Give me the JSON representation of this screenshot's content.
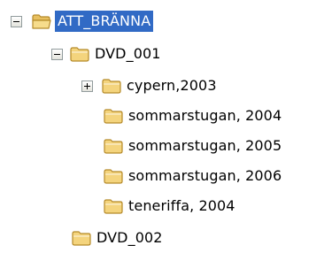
{
  "colors": {
    "selection_background": "#316ac5",
    "selection_text": "#ffffff",
    "folder_fill": "#f4d47d",
    "folder_outline": "#b58a2a",
    "expander_border": "#919b9c"
  },
  "tree": {
    "root": {
      "label": "ATT_BRÄNNA",
      "expander": "minus",
      "icon": "folder-open-icon",
      "selected": true
    },
    "dvd_001": {
      "label": "DVD_001",
      "expander": "minus",
      "icon": "folder-icon"
    },
    "children": [
      {
        "label": "cypern,2003",
        "expander": "plus",
        "icon": "folder-icon"
      },
      {
        "label": "sommarstugan, 2004",
        "expander": "",
        "icon": "folder-icon"
      },
      {
        "label": "sommarstugan, 2005",
        "expander": "",
        "icon": "folder-icon"
      },
      {
        "label": "sommarstugan, 2006",
        "expander": "",
        "icon": "folder-icon"
      },
      {
        "label": "teneriffa, 2004",
        "expander": "",
        "icon": "folder-icon"
      }
    ],
    "dvd_002": {
      "label": "DVD_002",
      "expander": "",
      "icon": "folder-icon"
    }
  }
}
